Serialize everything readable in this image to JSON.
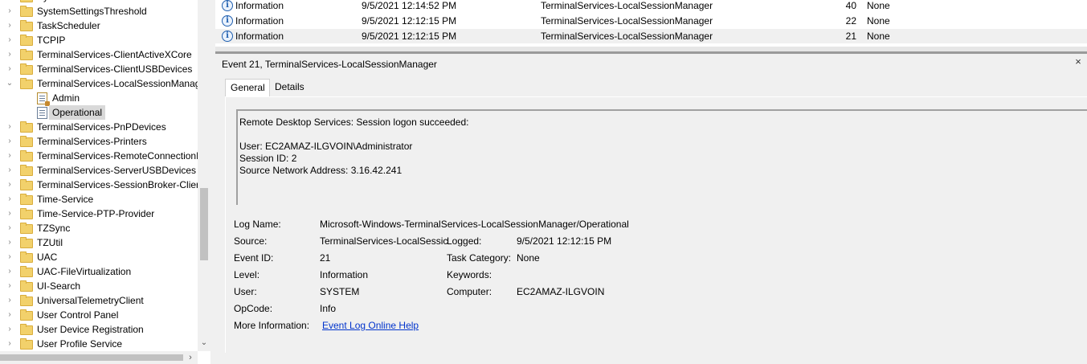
{
  "tree": {
    "items": [
      {
        "label": "SystemDataArchiver",
        "expanded": false
      },
      {
        "label": "SystemSettingsThreshold",
        "expanded": false
      },
      {
        "label": "TaskScheduler",
        "expanded": false
      },
      {
        "label": "TCPIP",
        "expanded": false
      },
      {
        "label": "TerminalServices-ClientActiveXCore",
        "expanded": false
      },
      {
        "label": "TerminalServices-ClientUSBDevices",
        "expanded": false
      },
      {
        "label": "TerminalServices-LocalSessionManag",
        "expanded": true
      },
      {
        "label": "Admin",
        "child": true
      },
      {
        "label": "Operational",
        "child": true,
        "selected": true
      },
      {
        "label": "TerminalServices-PnPDevices",
        "expanded": false
      },
      {
        "label": "TerminalServices-Printers",
        "expanded": false
      },
      {
        "label": "TerminalServices-RemoteConnectionM",
        "expanded": false
      },
      {
        "label": "TerminalServices-ServerUSBDevices",
        "expanded": false
      },
      {
        "label": "TerminalServices-SessionBroker-Clien",
        "expanded": false
      },
      {
        "label": "Time-Service",
        "expanded": false
      },
      {
        "label": "Time-Service-PTP-Provider",
        "expanded": false
      },
      {
        "label": "TZSync",
        "expanded": false
      },
      {
        "label": "TZUtil",
        "expanded": false
      },
      {
        "label": "UAC",
        "expanded": false
      },
      {
        "label": "UAC-FileVirtualization",
        "expanded": false
      },
      {
        "label": "UI-Search",
        "expanded": false
      },
      {
        "label": "UniversalTelemetryClient",
        "expanded": false
      },
      {
        "label": "User Control Panel",
        "expanded": false
      },
      {
        "label": "User Device Registration",
        "expanded": false
      },
      {
        "label": "User Profile Service",
        "expanded": false
      }
    ]
  },
  "events": {
    "rows": [
      {
        "level": "Information",
        "date": "9/5/2021 12:14:52 PM",
        "source": "TerminalServices-LocalSessionManager",
        "event_id": "40",
        "task": "None"
      },
      {
        "level": "Information",
        "date": "9/5/2021 12:12:15 PM",
        "source": "TerminalServices-LocalSessionManager",
        "event_id": "22",
        "task": "None"
      },
      {
        "level": "Information",
        "date": "9/5/2021 12:12:15 PM",
        "source": "TerminalServices-LocalSessionManager",
        "event_id": "21",
        "task": "None",
        "selected": true
      }
    ]
  },
  "detail": {
    "title": "Event 21, TerminalServices-LocalSessionManager",
    "close_glyph": "×",
    "tabs": {
      "general": "General",
      "details": "Details"
    },
    "message": {
      "line1": "Remote Desktop Services: Session logon succeeded:",
      "line2": "User: EC2AMAZ-ILGVOIN\\Administrator",
      "line3": "Session ID: 2",
      "line4": "Source Network Address: 3.16.42.241"
    },
    "fields": {
      "log_name_label": "Log Name:",
      "log_name_value": "Microsoft-Windows-TerminalServices-LocalSessionManager/Operational",
      "source_label": "Source:",
      "source_value": "TerminalServices-LocalSessic",
      "logged_label": "Logged:",
      "logged_value": "9/5/2021 12:12:15 PM",
      "event_id_label": "Event ID:",
      "event_id_value": "21",
      "task_category_label": "Task Category:",
      "task_category_value": "None",
      "level_label": "Level:",
      "level_value": "Information",
      "keywords_label": "Keywords:",
      "keywords_value": "",
      "user_label": "User:",
      "user_value": "SYSTEM",
      "computer_label": "Computer:",
      "computer_value": "EC2AMAZ-ILGVOIN",
      "opcode_label": "OpCode:",
      "opcode_value": "Info",
      "more_info_label": "More Information:",
      "more_info_link": "Event Log Online Help"
    }
  },
  "glyphs": {
    "expand": "›",
    "collapse": "⌄",
    "scroll_down": "⌄",
    "scroll_right": "›",
    "info": "i"
  },
  "colors": {
    "selection": "#d9d9d9",
    "link": "#0033cc",
    "info_icon": "#1f5fb0",
    "folder": "#f2d16b"
  }
}
